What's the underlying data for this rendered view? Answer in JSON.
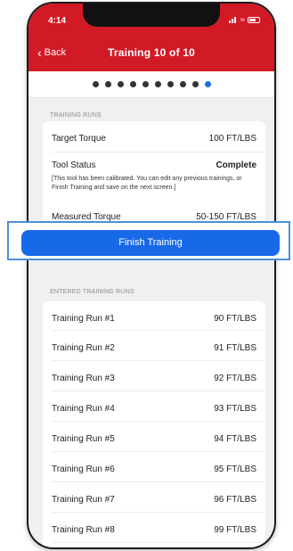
{
  "status_bar": {
    "time": "4:14"
  },
  "header": {
    "back_label": "Back",
    "title": "Training 10 of 10"
  },
  "progress": {
    "total_steps": 10,
    "current_step": 10
  },
  "training_runs": {
    "section_label": "TRAINING RUNS",
    "target_torque": {
      "label": "Target Torque",
      "value": "100 FT/LBS"
    },
    "tool_status": {
      "label": "Tool Status",
      "value": "Complete",
      "note": "[This tool has been calibrated. You can edit any previous trainings, or Finish Training and save on the next screen.]"
    },
    "measured_torque": {
      "label": "Measured Torque",
      "value": "50-150 FT/LBS"
    }
  },
  "finish_button": {
    "label": "Finish Training"
  },
  "entered_runs": {
    "section_label": "ENTERED TRAINING RUNS",
    "items": [
      {
        "label": "Training Run #1",
        "value": "90 FT/LBS"
      },
      {
        "label": "Training Run #2",
        "value": "91 FT/LBS"
      },
      {
        "label": "Training Run #3",
        "value": "92 FT/LBS"
      },
      {
        "label": "Training Run #4",
        "value": "93 FT/LBS"
      },
      {
        "label": "Training Run #5",
        "value": "94 FT/LBS"
      },
      {
        "label": "Training Run #6",
        "value": "95 FT/LBS"
      },
      {
        "label": "Training Run #7",
        "value": "96 FT/LBS"
      },
      {
        "label": "Training Run #8",
        "value": "99 FT/LBS"
      }
    ]
  },
  "colors": {
    "brand_red": "#d21a26",
    "accent_blue": "#1869e8",
    "highlight_border": "#4a90d9"
  }
}
